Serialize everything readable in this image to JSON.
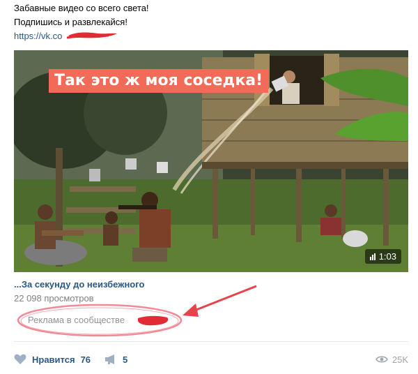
{
  "post": {
    "text_line_1": "Забавные видео со всего света!",
    "text_line_2": "Подпишись и развлекайся!",
    "link_text": "https://vk.co"
  },
  "video": {
    "caption": "Так это ж моя соседка!",
    "duration": "1:03",
    "title": "...За секунду до неизбежного",
    "views": "22 098 просмотров"
  },
  "ad": {
    "label": "Реклама в сообществе"
  },
  "actions": {
    "like_label": "Нравится",
    "like_count": "76",
    "share_count": "5",
    "views_count": "25K"
  },
  "colors": {
    "link": "#2a5885",
    "muted": "#828282",
    "caption_bg": "#f26b58",
    "annotation": "#e8424a"
  },
  "icons": {
    "like": "heart-icon",
    "share": "megaphone-icon",
    "views": "eye-icon",
    "duration": "video-bars-icon"
  }
}
